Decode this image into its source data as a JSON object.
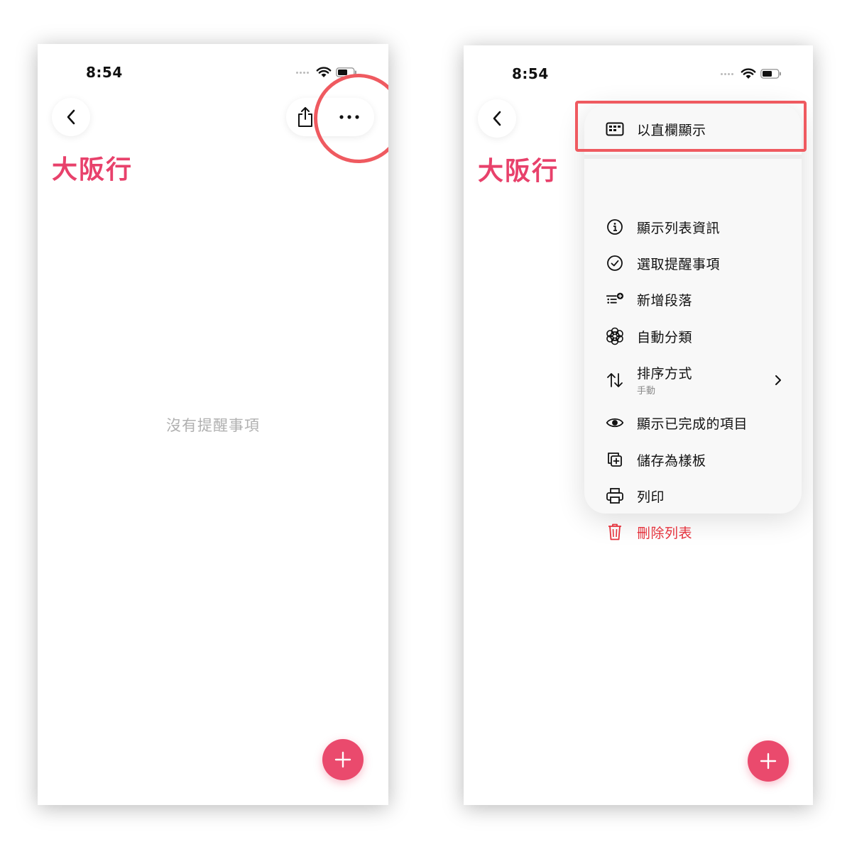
{
  "left_screen": {
    "status": {
      "time": "8:54"
    },
    "list_title": "大阪行",
    "empty_message": "沒有提醒事項"
  },
  "right_screen": {
    "status": {
      "time": "8:54"
    },
    "list_title": "大阪行",
    "menu": {
      "items": [
        {
          "label": "以直欄顯示",
          "icon": "columns-icon"
        },
        {
          "label": "顯示列表資訊",
          "icon": "info-icon"
        },
        {
          "label": "選取提醒事項",
          "icon": "checkmark-circle-icon"
        },
        {
          "label": "新增段落",
          "icon": "add-section-icon"
        },
        {
          "label": "自動分類",
          "icon": "auto-categorize-icon"
        },
        {
          "label": "排序方式",
          "sublabel": "手動",
          "icon": "sort-arrows-icon"
        },
        {
          "label": "顯示已完成的項目",
          "icon": "eye-icon"
        },
        {
          "label": "儲存為樣板",
          "icon": "duplicate-icon"
        },
        {
          "label": "列印",
          "icon": "printer-icon"
        },
        {
          "label": "刪除列表",
          "icon": "trash-icon",
          "destructive": true
        }
      ]
    }
  },
  "colors": {
    "accent": "#e8416b",
    "fab": "#ea4a6d",
    "highlight": "#ef5a60",
    "destructive": "#e5333d",
    "empty_text": "#b0b0b0"
  }
}
